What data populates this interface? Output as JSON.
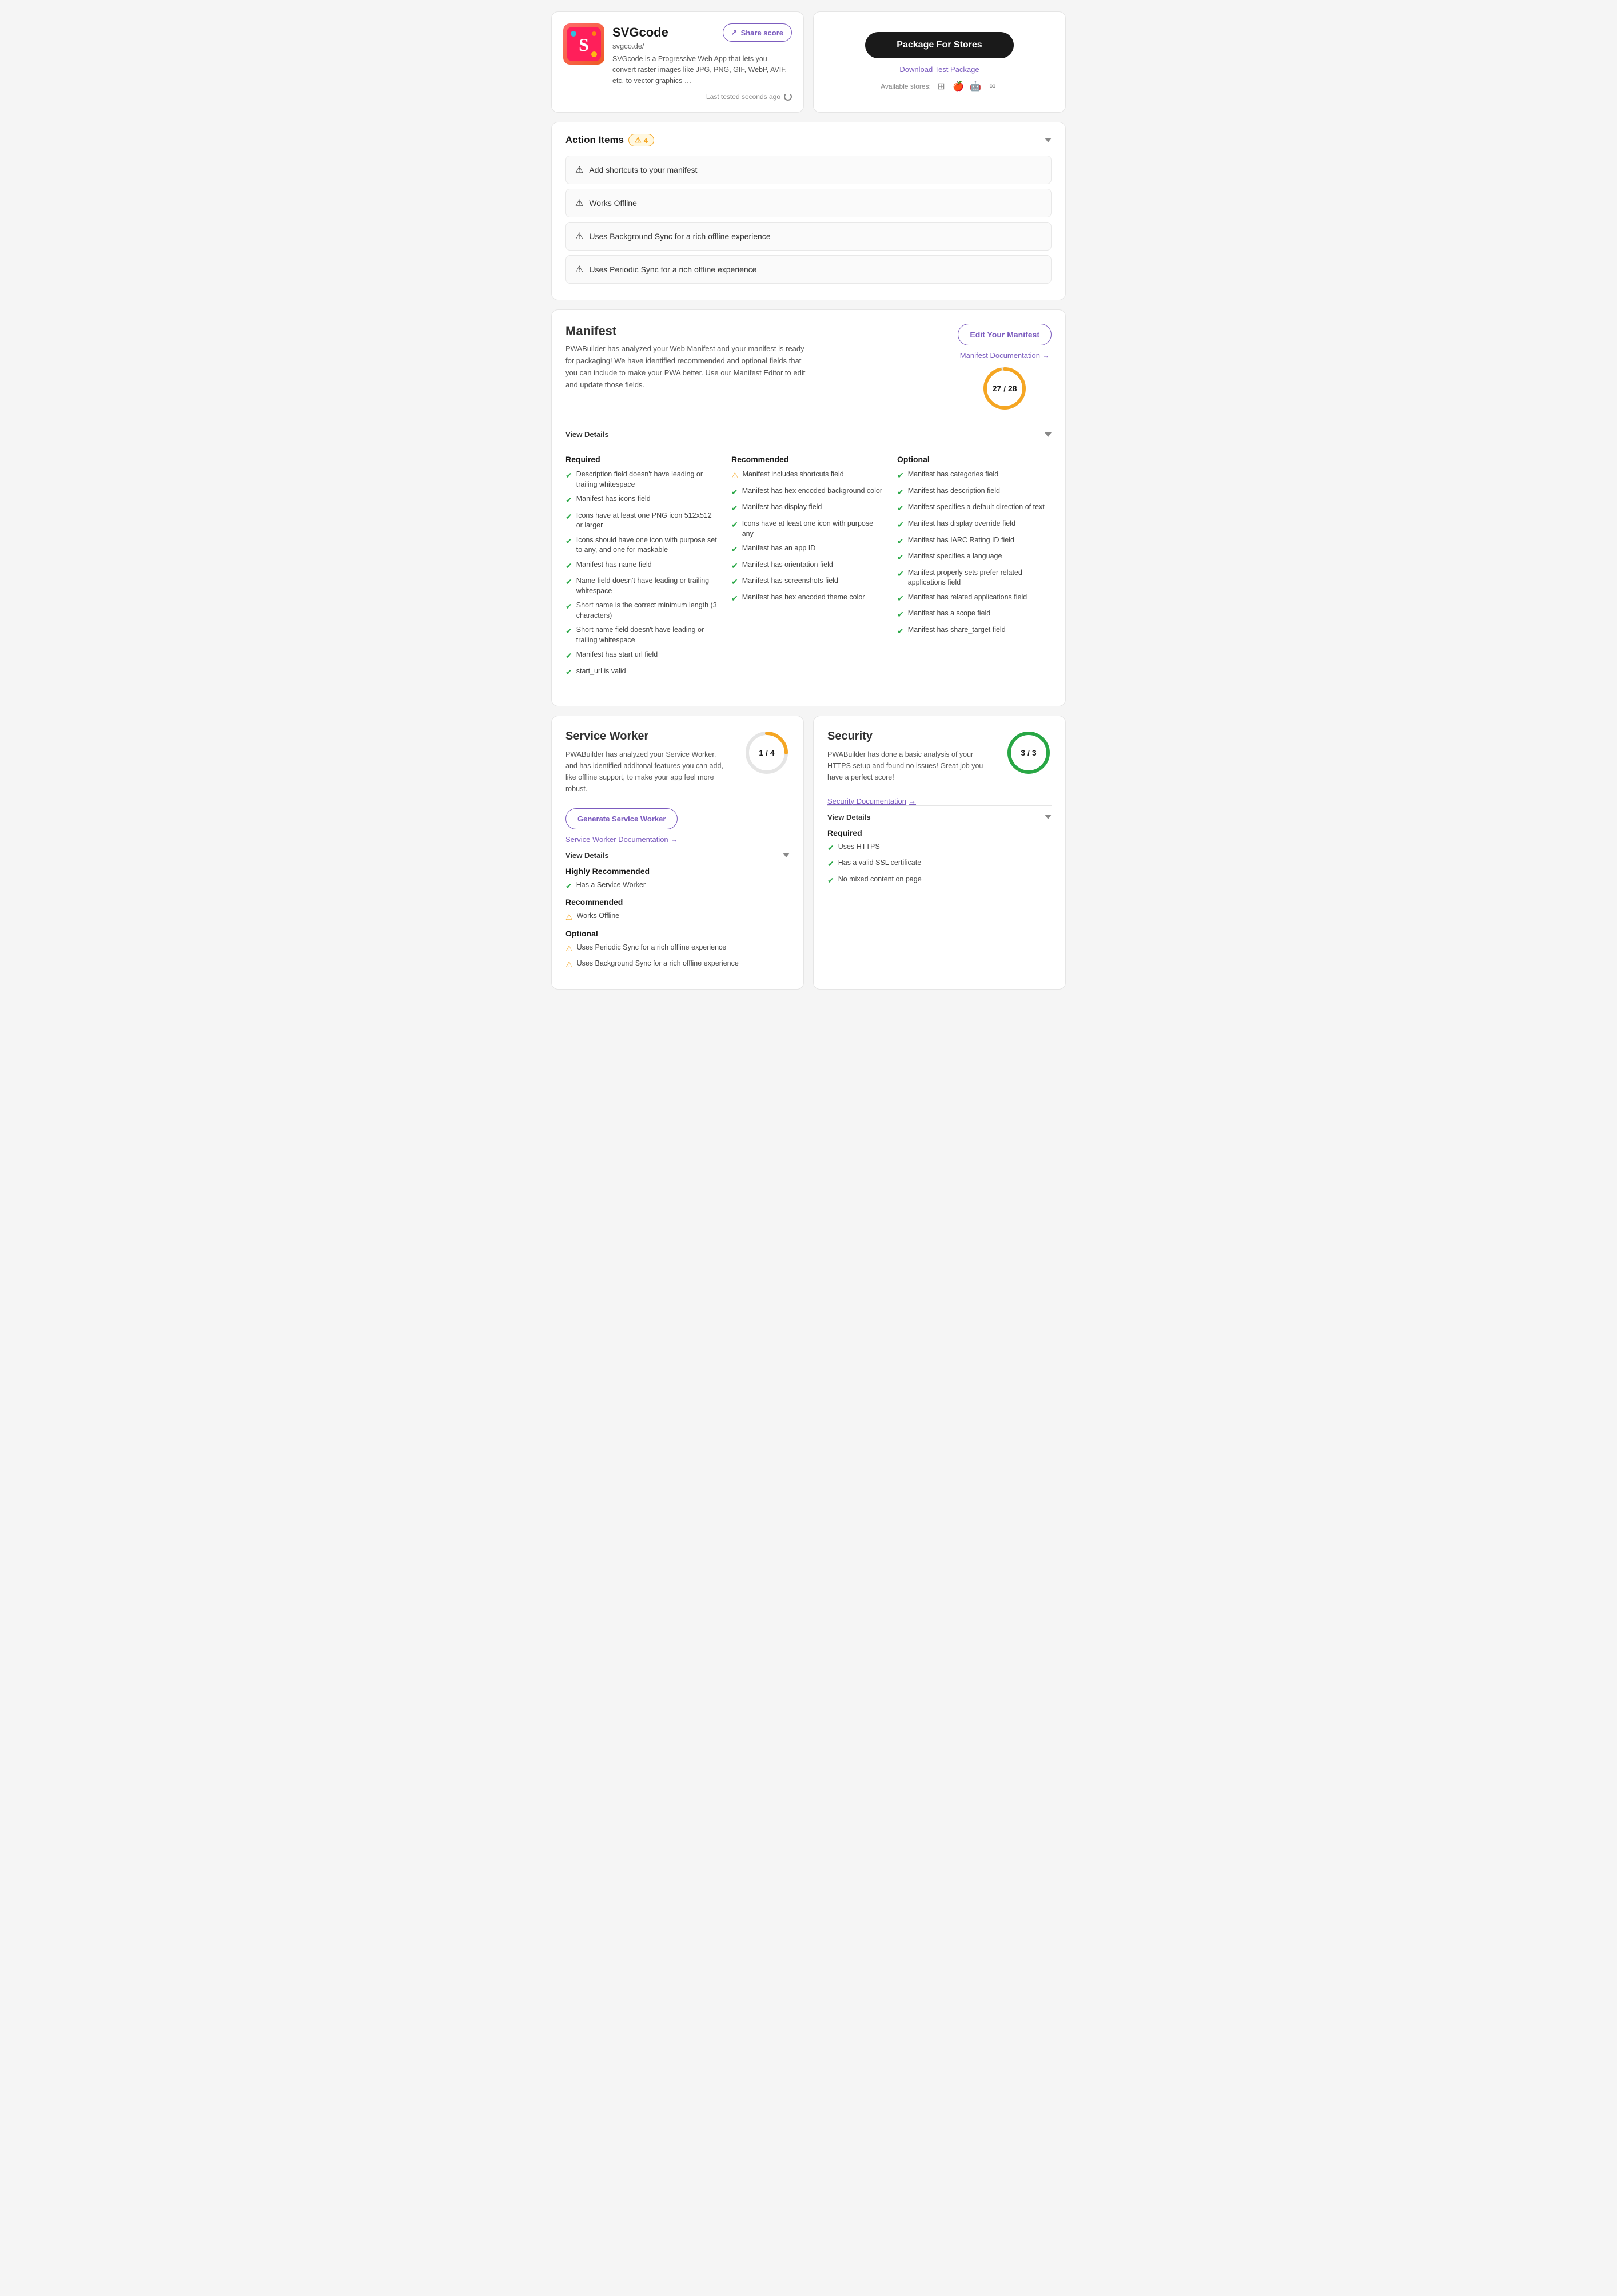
{
  "app": {
    "name": "SVGcode",
    "url": "svgco.de/",
    "description": "SVGcode is a Progressive Web App that lets you convert raster images like JPG, PNG, GIF, WebP, AVIF, etc. to vector graphics …",
    "last_tested": "Last tested seconds ago"
  },
  "share_btn": "Share score",
  "store": {
    "package_btn": "Package For Stores",
    "download_link": "Download Test Package",
    "available_label": "Available stores:"
  },
  "action_items": {
    "title": "Action Items",
    "count": "4",
    "items": [
      "Add shortcuts to your manifest",
      "Works Offline",
      "Uses Background Sync for a rich offline experience",
      "Uses Periodic Sync for a rich offline experience"
    ]
  },
  "manifest": {
    "title": "Manifest",
    "description": "PWABuilder has analyzed your Web Manifest and your manifest is ready for packaging! We have identified recommended and optional fields that you can include to make your PWA better. Use our Manifest Editor to edit and update those fields.",
    "edit_btn": "Edit Your Manifest",
    "doc_link": "Manifest Documentation",
    "score_current": "27",
    "score_total": "28",
    "score_display": "27 / 28",
    "score_pct": 96,
    "view_details": "View Details",
    "required": {
      "title": "Required",
      "items": [
        {
          "status": "check",
          "text": "Description field doesn't have leading or trailing whitespace"
        },
        {
          "status": "check",
          "text": "Manifest has icons field"
        },
        {
          "status": "check",
          "text": "Icons have at least one PNG icon 512x512 or larger"
        },
        {
          "status": "check",
          "text": "Icons should have one icon with purpose set to any, and one for maskable"
        },
        {
          "status": "check",
          "text": "Manifest has name field"
        },
        {
          "status": "check",
          "text": "Name field doesn't have leading or trailing whitespace"
        },
        {
          "status": "check",
          "text": "Short name is the correct minimum length (3 characters)"
        },
        {
          "status": "check",
          "text": "Short name field doesn't have leading or trailing whitespace"
        },
        {
          "status": "check",
          "text": "Manifest has start url field"
        },
        {
          "status": "check",
          "text": "start_url is valid"
        }
      ]
    },
    "recommended": {
      "title": "Recommended",
      "items": [
        {
          "status": "warn",
          "text": "Manifest includes shortcuts field"
        },
        {
          "status": "check",
          "text": "Manifest has hex encoded background color"
        },
        {
          "status": "check",
          "text": "Manifest has display field"
        },
        {
          "status": "check",
          "text": "Icons have at least one icon with purpose any"
        },
        {
          "status": "check",
          "text": "Manifest has an app ID"
        },
        {
          "status": "check",
          "text": "Manifest has orientation field"
        },
        {
          "status": "check",
          "text": "Manifest has screenshots field"
        },
        {
          "status": "check",
          "text": "Manifest has hex encoded theme color"
        }
      ]
    },
    "optional": {
      "title": "Optional",
      "items": [
        {
          "status": "check",
          "text": "Manifest has categories field"
        },
        {
          "status": "check",
          "text": "Manifest has description field"
        },
        {
          "status": "check",
          "text": "Manifest specifies a default direction of text"
        },
        {
          "status": "check",
          "text": "Manifest has display override field"
        },
        {
          "status": "check",
          "text": "Manifest has IARC Rating ID field"
        },
        {
          "status": "check",
          "text": "Manifest specifies a language"
        },
        {
          "status": "check",
          "text": "Manifest properly sets prefer related applications field"
        },
        {
          "status": "check",
          "text": "Manifest has related applications field"
        },
        {
          "status": "check",
          "text": "Manifest has a scope field"
        },
        {
          "status": "check",
          "text": "Manifest has share_target field"
        }
      ]
    }
  },
  "service_worker": {
    "title": "Service Worker",
    "description": "PWABuilder has analyzed your Service Worker, and has identified additonal features you can add, like offline support, to make your app feel more robust.",
    "score_current": "1",
    "score_total": "4",
    "score_display": "1 / 4",
    "score_pct": 25,
    "generate_btn": "Generate Service Worker",
    "doc_link": "Service Worker Documentation",
    "view_details": "View Details",
    "highly_recommended": {
      "title": "Highly Recommended",
      "items": [
        {
          "status": "check",
          "text": "Has a Service Worker"
        }
      ]
    },
    "recommended": {
      "title": "Recommended",
      "items": [
        {
          "status": "warn",
          "text": "Works Offline"
        }
      ]
    },
    "optional": {
      "title": "Optional",
      "items": [
        {
          "status": "warn",
          "text": "Uses Periodic Sync for a rich offline experience"
        },
        {
          "status": "warn",
          "text": "Uses Background Sync for a rich offline experience"
        }
      ]
    }
  },
  "security": {
    "title": "Security",
    "description": "PWABuilder has done a basic analysis of your HTTPS setup and found no issues! Great job you have a perfect score!",
    "score_current": "3",
    "score_total": "3",
    "score_display": "3 / 3",
    "score_pct": 100,
    "doc_link": "Security Documentation",
    "view_details": "View Details",
    "required": {
      "title": "Required",
      "items": [
        {
          "status": "check",
          "text": "Uses HTTPS"
        },
        {
          "status": "check",
          "text": "Has a valid SSL certificate"
        },
        {
          "status": "check",
          "text": "No mixed content on page"
        }
      ]
    }
  },
  "icons": {
    "share": "↗",
    "chevron_down": "▾",
    "arrow_right": "→",
    "refresh": "↻",
    "warning": "⚠",
    "check": "✔"
  },
  "colors": {
    "purple": "#7c5cbf",
    "yellow": "#f5a623",
    "green": "#28a745",
    "dark": "#1a1a1a",
    "manifest_score_color": "#f5a623",
    "sw_score_color": "#f5a623",
    "sec_score_color": "#28a745"
  }
}
